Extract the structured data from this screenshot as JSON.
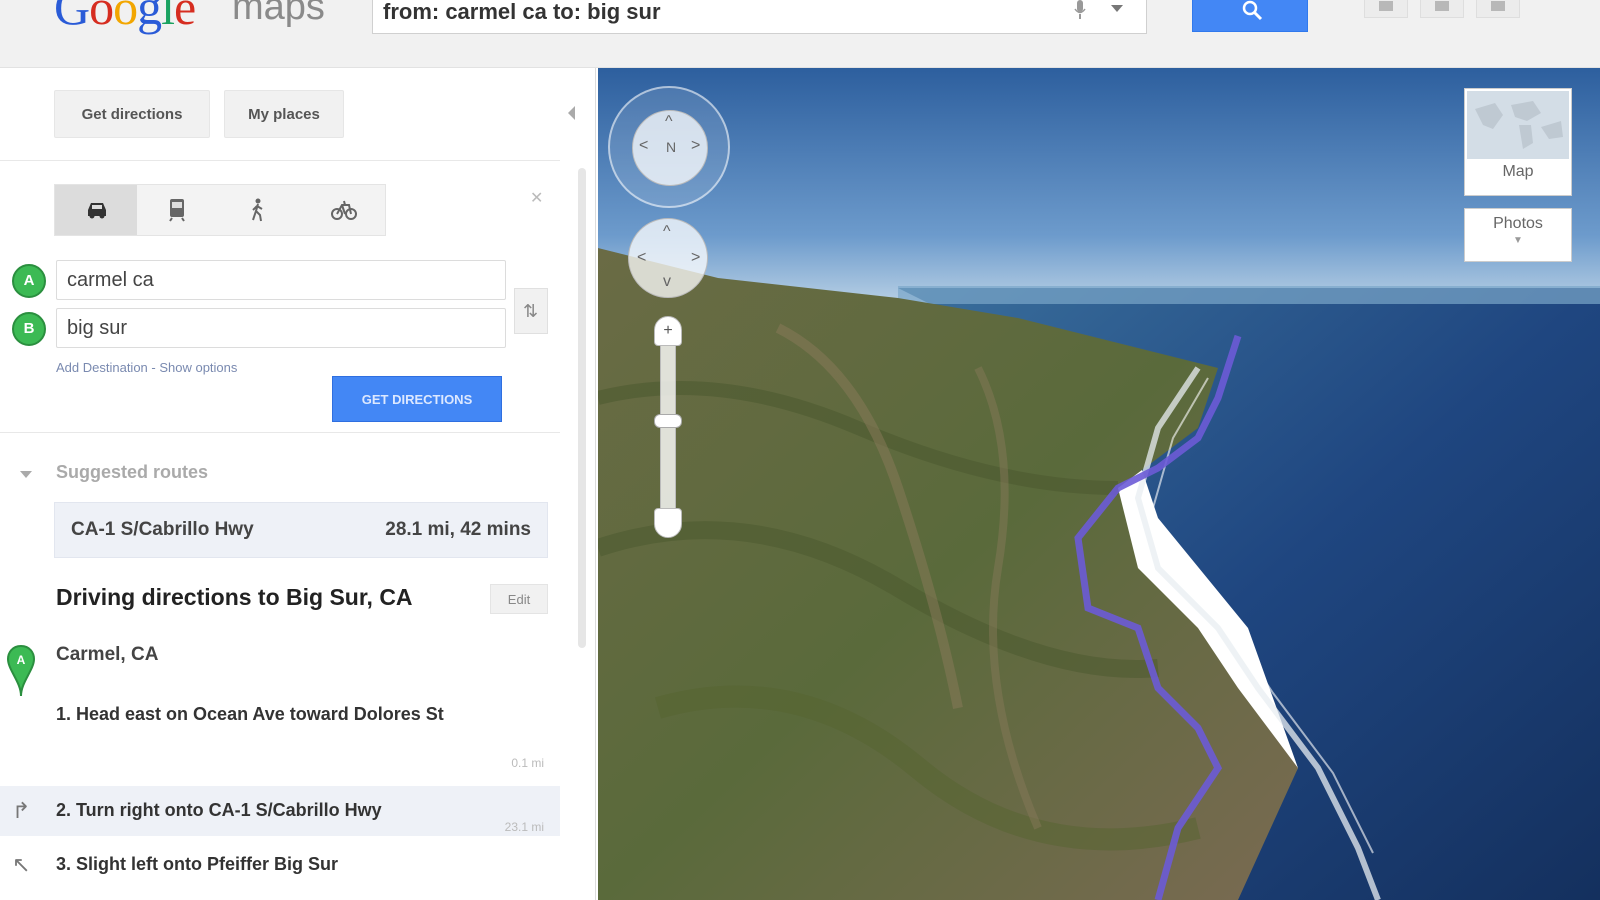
{
  "header": {
    "logo_google": "Google",
    "logo_maps": "maps",
    "search_value": "from: carmel ca to: big sur"
  },
  "tabs": {
    "get_directions": "Get directions",
    "my_places": "My places"
  },
  "travel_modes": [
    "car-icon",
    "transit-icon",
    "walk-icon",
    "bike-icon"
  ],
  "route_inputs": {
    "start_marker": "A",
    "start_value": "carmel ca",
    "end_marker": "B",
    "end_value": "big sur",
    "extra_links": "Add Destination - Show options",
    "get_directions_button": "GET DIRECTIONS"
  },
  "suggested": {
    "heading": "Suggested routes",
    "route_name": "CA-1 S/Cabrillo Hwy",
    "route_distance": "28.1 mi, 42 mins"
  },
  "directions": {
    "title": "Driving directions to Big Sur, CA",
    "edit_label": "Edit",
    "start": "Carmel, CA",
    "steps": [
      {
        "text": "1. Head east on Ocean Ave toward Dolores St",
        "meta": "0.1 mi"
      },
      {
        "text": "2. Turn right onto CA-1 S/Cabrillo Hwy",
        "meta": "23.1 mi"
      },
      {
        "text": "3. Slight left onto Pfeiffer Big Sur",
        "meta": ""
      }
    ]
  },
  "map": {
    "map_type_label": "Map",
    "photos_label": "Photos",
    "route_color": "#6b5bd6",
    "sea_color": "#1e3f78",
    "sky_color": "#3a6fae"
  },
  "colors": {
    "accent": "#4387f5",
    "marker_green": "#3cba54"
  }
}
